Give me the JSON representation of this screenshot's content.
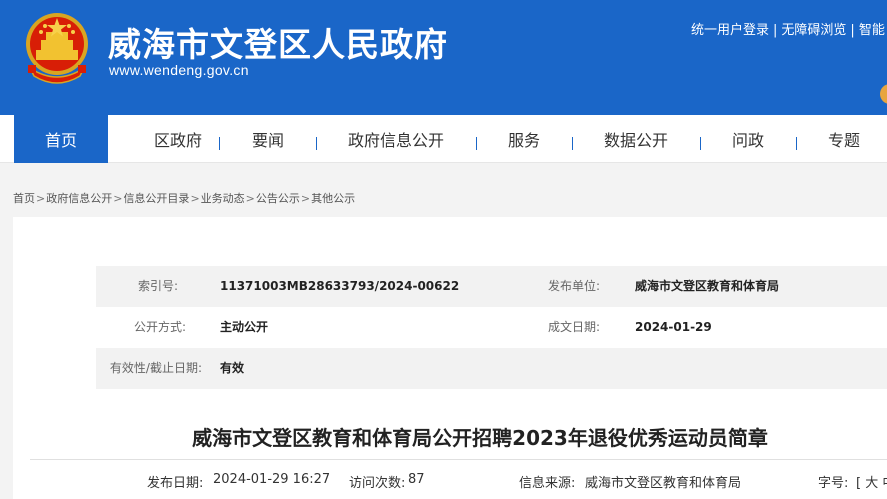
{
  "header": {
    "site_title": "威海市文登区人民政府",
    "site_url": "www.wendeng.gov.cn",
    "links": [
      "统一用户登录",
      "无障碍浏览",
      "智能"
    ],
    "link_separator": "|",
    "brand_color": "#1a66c8"
  },
  "nav": {
    "items": [
      "首页",
      "区政府",
      "要闻",
      "政府信息公开",
      "服务",
      "数据公开",
      "问政",
      "专题"
    ],
    "active_index": 0
  },
  "breadcrumb": {
    "items": [
      "首页",
      "政府信息公开",
      "信息公开目录",
      "业务动态",
      "公告公示",
      "其他公示"
    ],
    "separator": ">"
  },
  "meta": {
    "index_label": "索引号:",
    "index_value": "11371003MB28633793/2024-00622",
    "publisher_label": "发布单位:",
    "publisher_value": "威海市文登区教育和体育局",
    "open_mode_label": "公开方式:",
    "open_mode_value": "主动公开",
    "doc_date_label": "成文日期:",
    "doc_date_value": "2024-01-29",
    "validity_label": "有效性/截止日期:",
    "validity_value": "有效"
  },
  "article": {
    "title": "威海市文登区教育和体育局公开招聘2023年退役优秀运动员简章",
    "publish_date_label": "发布日期:",
    "publish_date_value": "2024-01-29 16:27",
    "visits_label": "访问次数:",
    "visits_value": "87",
    "source_label": "信息来源:",
    "source_value": "威海市文登区教育和体育局",
    "font_size_label": "字号:",
    "font_size_open": "[",
    "font_size_large": "大",
    "font_size_medium": "中"
  }
}
